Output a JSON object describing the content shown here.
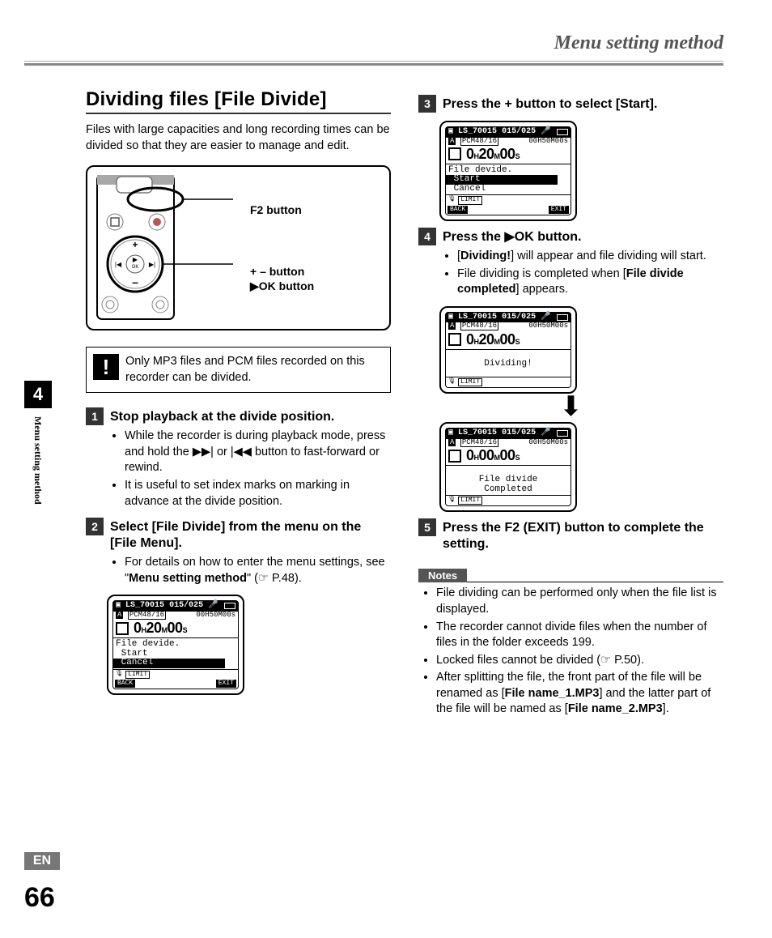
{
  "header": {
    "running": "Menu setting method"
  },
  "side": {
    "chapter": "4",
    "vlabel": "Menu setting method",
    "lang": "EN",
    "page": "66"
  },
  "left": {
    "title": "Dividing files [File Divide]",
    "intro": "Files with large capacities and long recording times can be divided so that they are easier to manage and edit.",
    "callouts": {
      "f2": "F2 button",
      "plusminus": "+ – button",
      "ok": "▶OK button"
    },
    "note": "Only MP3 files and PCM files recorded on this recorder can be divided.",
    "steps": [
      {
        "num": "1",
        "title": "Stop playback at the divide position.",
        "bullets": [
          "While the recorder is during playback mode, press and hold the ▶▶| or |◀◀ button to fast-forward or rewind.",
          "It is useful to set index marks on marking in advance at the divide position."
        ]
      },
      {
        "num": "2",
        "title_parts": [
          "Select [",
          "File Divide",
          "] from the menu on the [",
          "File Menu",
          "]."
        ],
        "bullets": [
          "For details on how to enter the menu settings, see \"Menu setting method\" (☞ P.48)."
        ]
      }
    ]
  },
  "right": {
    "steps": [
      {
        "num": "3",
        "title_parts": [
          "Press the + button to select [",
          "Start",
          "]."
        ]
      },
      {
        "num": "4",
        "title_parts": [
          "Press the ",
          "▶OK",
          " button."
        ],
        "bullets": [
          "[Dividing!] will appear and file dividing will start.",
          "File dividing is completed when [File divide completed] appears."
        ]
      },
      {
        "num": "5",
        "title_parts": [
          "Press the ",
          "F2",
          " (",
          "EXIT",
          ") button to complete the setting."
        ]
      }
    ],
    "notes_label": "Notes",
    "notes": [
      "File dividing can be performed only when the file list is displayed.",
      "The recorder cannot divide files when the number of files in the folder exceeds 199.",
      "Locked files cannot be divided (☞ P.50).",
      "After splitting the file, the front part of the file will be renamed as [File name_1.MP3] and the latter part of the file will be named as [File name_2.MP3]."
    ]
  },
  "lcd": {
    "file": "LS_70015",
    "counter": "015/025",
    "format": "PCM48/16",
    "duration": "00H50M00s",
    "time_20": {
      "h": "0",
      "m": "20",
      "s": "00"
    },
    "time_00": {
      "h": "0",
      "m": "00",
      "s": "00"
    },
    "menu_title": "File devide.",
    "menu_start": "Start",
    "menu_cancel": "Cancel",
    "dividing": "Dividing!",
    "completed_l1": "File divide",
    "completed_l2": "Completed",
    "btn_back": "BACK",
    "btn_exit": "EXIT",
    "chip_limit": "LIMIT"
  }
}
